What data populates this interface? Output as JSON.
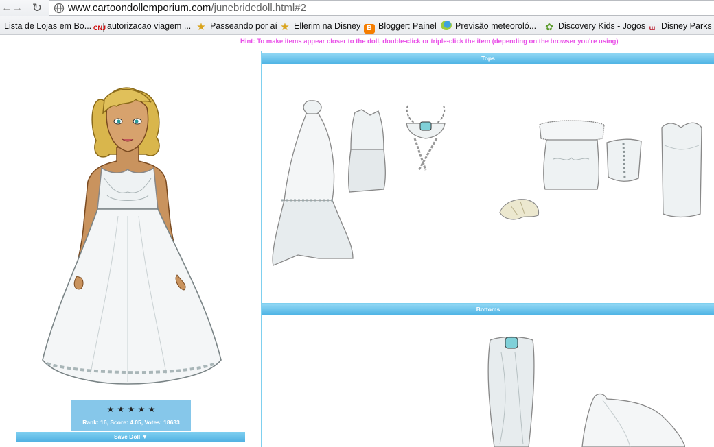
{
  "browser": {
    "url_host": "www.cartoondollemporium.com",
    "url_path": "/junebridedoll.html#2"
  },
  "bookmarks": [
    {
      "label": "Lista de Lojas em Bo...",
      "icon": "none"
    },
    {
      "label": "autorizacao viagem ...",
      "icon": "cnn-icon"
    },
    {
      "label": "Passeando por aí",
      "icon": "star-icon"
    },
    {
      "label": "Ellerim na Disney",
      "icon": "star-icon"
    },
    {
      "label": "Blogger: Painel",
      "icon": "blogger-icon"
    },
    {
      "label": "Previsão meteoroló...",
      "icon": "weather-icon"
    },
    {
      "label": "Discovery Kids - Jogos",
      "icon": "kids-icon"
    },
    {
      "label": "Disney Parks ot",
      "icon": "disney-icon"
    }
  ],
  "hint": "Hint: To make items appear closer to the doll, double-click or triple-click the item (depending on the browser you're using)",
  "doll": {
    "rating": {
      "stars": 5,
      "text": "Rank: 16, Score: 4.05, Votes: 18633"
    },
    "save_label": "Save Doll ▼"
  },
  "sections": {
    "tops": "Tops",
    "bottoms": "Bottoms"
  }
}
